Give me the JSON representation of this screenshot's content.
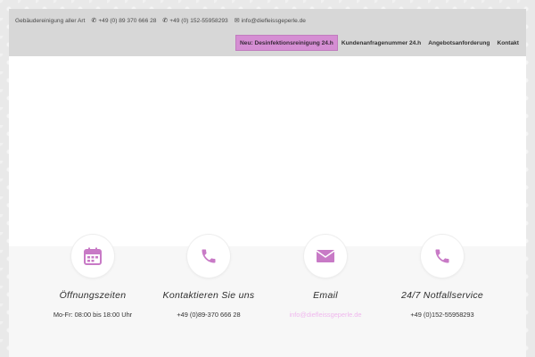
{
  "topbar": {
    "tagline": "Gebäudereinigung aller Art",
    "phone1": "+49 (0) 89 370 666 28",
    "phone2": "+49 (0) 152-55958293",
    "email": "info@diefleissgeperle.de",
    "icons": {
      "phone": "phone-icon",
      "email": "envelope-icon"
    }
  },
  "nav": {
    "items": [
      {
        "label": "Neu: Desinfektionsreinigung 24.h",
        "active": true
      },
      {
        "label": "Kundenanfragenummer 24.h"
      },
      {
        "label": "Angebotsanforderung"
      },
      {
        "label": "Kontakt"
      }
    ]
  },
  "features": [
    {
      "icon": "calendar-icon",
      "title": "Öffnungszeiten",
      "text": "Mo-Fr: 08:00 bis 18:00 Uhr"
    },
    {
      "icon": "phone-icon",
      "title": "Kontaktieren Sie uns",
      "text": "+49 (0)89-370 666 28"
    },
    {
      "icon": "envelope-icon",
      "title": "Email",
      "text": "info@diefleissgeperle.de"
    },
    {
      "icon": "phone-icon",
      "title": "24/7 Notfallservice",
      "text": "+49 (0)152-55958293"
    }
  ],
  "colors": {
    "accent": "#d58ed3",
    "icon": "#c87ac6",
    "header_bg": "#d7d7d7",
    "link": "#f0b8ee"
  }
}
